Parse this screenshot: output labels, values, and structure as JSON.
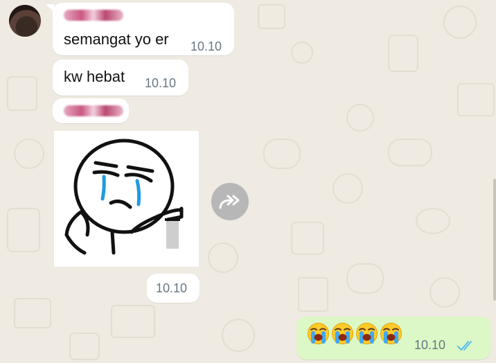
{
  "messages": [
    {
      "sender_redacted": true,
      "text": "semangat yo er",
      "time": "10.10"
    },
    {
      "text": "kw hebat",
      "time": "10.10"
    },
    {
      "sender_redacted": true,
      "type": "sticker",
      "sticker": "crying-stickman-sticker",
      "time": "10.10"
    }
  ],
  "outgoing": {
    "emoji": [
      "😭",
      "😭",
      "😭",
      "😭"
    ],
    "time": "10.10",
    "status": "read",
    "status_icon": "double-check-icon"
  },
  "forward_icon": "forward-icon",
  "colors": {
    "wallpaper": "#efeae2",
    "incoming_bubble": "#ffffff",
    "outgoing_bubble": "#dcf8c6",
    "timestamp": "#667781",
    "read_ticks": "#53bdeb"
  }
}
